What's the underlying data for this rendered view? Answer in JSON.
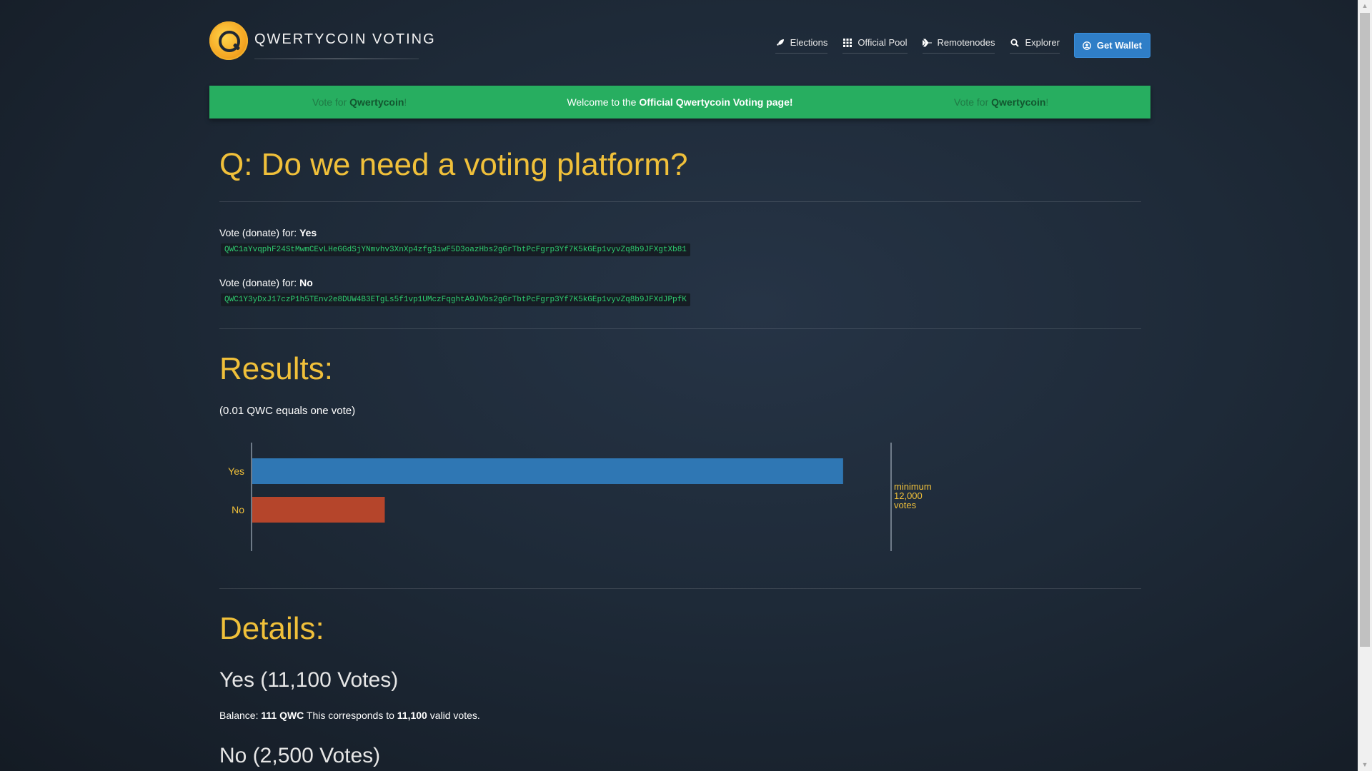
{
  "header": {
    "brand": "QWERTYCOIN VOTING",
    "nav": [
      {
        "label": "Elections",
        "icon": "rocket-icon"
      },
      {
        "label": "Official Pool",
        "icon": "grid-icon"
      },
      {
        "label": "Remotenodes",
        "icon": "plane-icon"
      },
      {
        "label": "Explorer",
        "icon": "search-icon"
      }
    ],
    "wallet_button": "Get Wallet"
  },
  "banner": {
    "side_prefix": "Vote for ",
    "side_brand": "Qwertycoin",
    "side_suffix": "!",
    "welcome_prefix": "Welcome to the ",
    "welcome_bold": "Official Qwertycoin Voting page!"
  },
  "question": "Q: Do we need a voting platform?",
  "votes": {
    "prefix": "Vote (donate) for: ",
    "yes_label": "Yes",
    "yes_address": "QWC1aYvqphF24StMwmCEvLHeGGdSjYNmvhv3XnXp4zfg3iwF5D3oazHbs2gGrTbtPcFgrp3Yf7K5kGEp1vyvZq8b9JFXgtXb81",
    "no_label": "No",
    "no_address": "QWC1Y3yDxJ17czP1h5TEnv2e8DUW4B3ETgLs5f1vp1UMczFqghtA9JVbs2gGrTbtPcFgrp3Yf7K5kGEp1vyvZq8b9JFXdJPpfK"
  },
  "results": {
    "title": "Results:",
    "note": "(0.01 QWC equals one vote)"
  },
  "chart_data": {
    "type": "bar",
    "orientation": "horizontal",
    "categories": [
      "Yes",
      "No"
    ],
    "values": [
      11100,
      2500
    ],
    "colors": [
      "#2f77b4",
      "#b5452b"
    ],
    "xlim": [
      0,
      12000
    ],
    "threshold": {
      "value": 12000,
      "label": [
        "minimum",
        "12,000",
        "votes"
      ]
    }
  },
  "details": {
    "title": "Details:",
    "yes_heading": "Yes (11,100 Votes)",
    "balance_label": "Balance:",
    "balance_value": "111 QWC",
    "corresponds": "This corresponds to",
    "valid_votes_value": "11,100",
    "valid_votes_suffix": "valid votes.",
    "no_heading": "No (2,500 Votes)"
  },
  "colors": {
    "accent_gold": "#f0c03a",
    "banner_green": "#27ae60",
    "address_green": "#2ecc71",
    "wallet_blue": "#2f7ec7"
  }
}
